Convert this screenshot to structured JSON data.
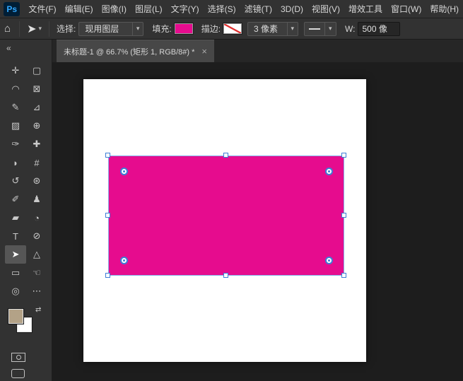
{
  "app": {
    "logo_text": "Ps",
    "menus": [
      "文件(F)",
      "编辑(E)",
      "图像(I)",
      "图层(L)",
      "文字(Y)",
      "选择(S)",
      "滤镜(T)",
      "3D(D)",
      "视图(V)",
      "增效工具",
      "窗口(W)",
      "帮助(H)"
    ]
  },
  "options": {
    "home_icon": "⌂",
    "tool_icon": "➤",
    "caret": "▾",
    "select_label": "选择:",
    "select_value": "现用图层",
    "fill_label": "填充:",
    "fill_color": "#e60c8e",
    "stroke_label": "描边:",
    "stroke_width_value": "3 像素",
    "width_label": "W:",
    "width_value": "500 像"
  },
  "tabbar": {
    "title": "未标题-1 @ 66.7% (矩形 1, RGB/8#) *",
    "close_icon": "×"
  },
  "toolbar": {
    "collapse_icon": "«",
    "foreground_color": "#b3a287",
    "background_color": "#ffffff",
    "tools": [
      {
        "name": "move-tool",
        "glyph": "✛"
      },
      {
        "name": "marquee-tool",
        "glyph": "▢"
      },
      {
        "name": "lasso-tool",
        "glyph": "◠"
      },
      {
        "name": "frame-tool",
        "glyph": "⊠"
      },
      {
        "name": "quick-selection-tool",
        "glyph": "✎"
      },
      {
        "name": "ruler-tool",
        "glyph": "⊿"
      },
      {
        "name": "gradient-tool",
        "glyph": "▨"
      },
      {
        "name": "clone-source-tool",
        "glyph": "⊕"
      },
      {
        "name": "eyedropper-tool",
        "glyph": "✑"
      },
      {
        "name": "healing-brush-tool",
        "glyph": "✚"
      },
      {
        "name": "blur-tool",
        "glyph": "◗"
      },
      {
        "name": "crop-tool",
        "glyph": "#"
      },
      {
        "name": "history-brush-tool",
        "glyph": "↺"
      },
      {
        "name": "patch-tool",
        "glyph": "⊛"
      },
      {
        "name": "brush-tool",
        "glyph": "✐"
      },
      {
        "name": "clone-stamp-tool",
        "glyph": "♟"
      },
      {
        "name": "eraser-tool",
        "glyph": "▰"
      },
      {
        "name": "dodge-tool",
        "glyph": "◔"
      },
      {
        "name": "type-tool",
        "glyph": "T"
      },
      {
        "name": "pen-tool",
        "glyph": "⊘"
      },
      {
        "name": "path-selection-tool",
        "glyph": "➤",
        "selected": true
      },
      {
        "name": "polygon-tool",
        "glyph": "△"
      },
      {
        "name": "rectangle-tool",
        "glyph": "▭"
      },
      {
        "name": "hand-tool",
        "glyph": "☜"
      },
      {
        "name": "zoom-tool",
        "glyph": "◎"
      },
      {
        "name": "edit-toolbar",
        "glyph": "⋯"
      }
    ]
  },
  "canvas": {
    "shape_fill": "#e60c8e",
    "selection_color": "#3d7dd6"
  }
}
